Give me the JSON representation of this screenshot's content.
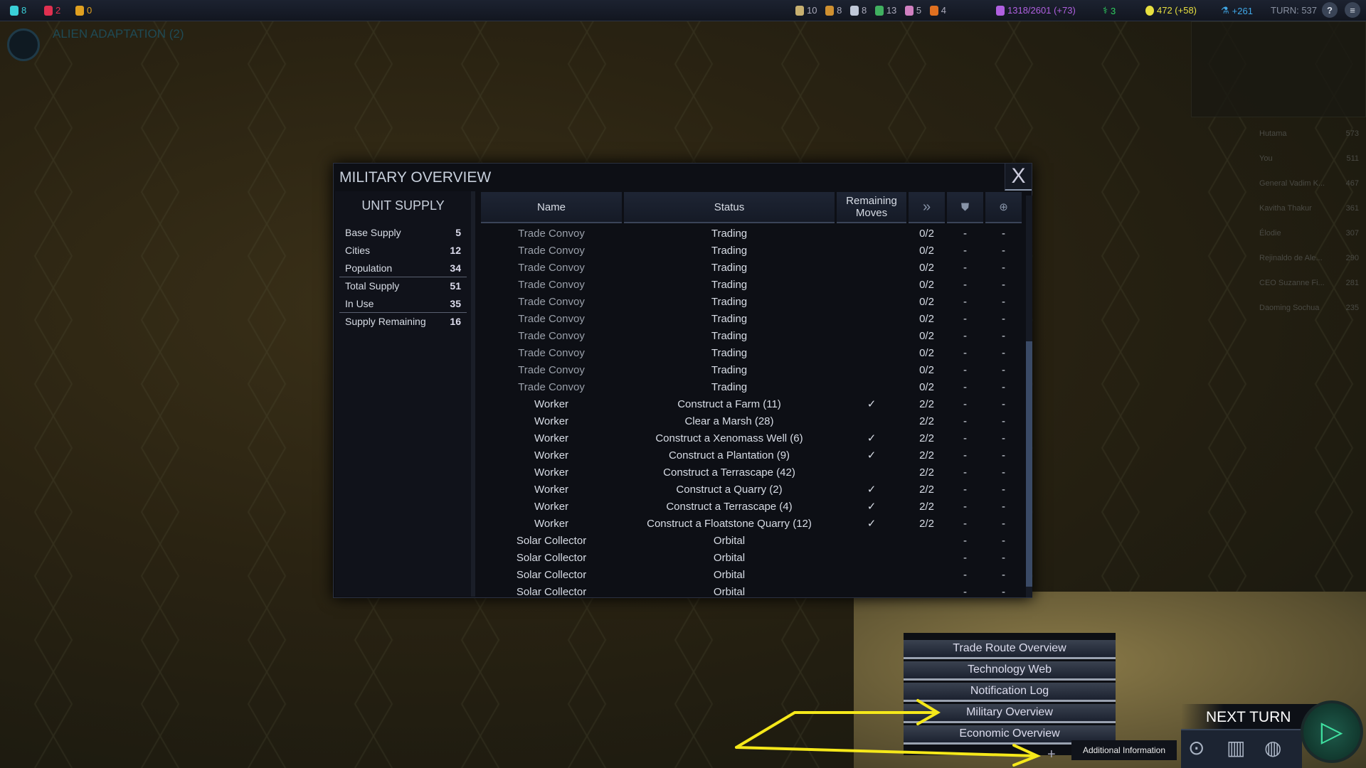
{
  "topbar": {
    "left": [
      {
        "icon": "affinity-harmony-icon",
        "value": "8",
        "color": "#3ad0d8"
      },
      {
        "icon": "affinity-purity-icon",
        "value": "2",
        "color": "#e03050"
      },
      {
        "icon": "affinity-supremacy-icon",
        "value": "0",
        "color": "#e0a020"
      }
    ],
    "resources": [
      {
        "icon": "firaxite-icon",
        "value": "10"
      },
      {
        "icon": "floatstone-icon",
        "value": "8"
      },
      {
        "icon": "titanium-icon",
        "value": "8"
      },
      {
        "icon": "geothermal-icon",
        "value": "13"
      },
      {
        "icon": "xenomass-icon",
        "value": "5"
      },
      {
        "icon": "petroleum-icon",
        "value": "4"
      }
    ],
    "culture": "1318/2601 (+73)",
    "health": "3",
    "energy": "472 (+58)",
    "science": "+261",
    "turn": "TURN: 537"
  },
  "quest": {
    "title": "ALIEN ADAPTATION (2)"
  },
  "scoreboard": [
    {
      "name": "Hutama",
      "score": "573"
    },
    {
      "name": "You",
      "score": "511"
    },
    {
      "name": "General Vadim K...",
      "score": "467"
    },
    {
      "name": "Kavitha Thakur",
      "score": "361"
    },
    {
      "name": "Élodie",
      "score": "307"
    },
    {
      "name": "Rejinaldo de Ale...",
      "score": "290"
    },
    {
      "name": "CEO Suzanne Fi...",
      "score": "281"
    },
    {
      "name": "Daoming Sochua",
      "score": "235"
    }
  ],
  "panel": {
    "title": "MILITARY OVERVIEW",
    "close": "X",
    "supply": {
      "title": "UNIT SUPPLY",
      "rows": [
        {
          "label": "Base Supply",
          "value": "5"
        },
        {
          "label": "Cities",
          "value": "12"
        },
        {
          "label": "Population",
          "value": "34"
        },
        {
          "label": "Total Supply",
          "value": "51"
        },
        {
          "label": "In Use",
          "value": "35"
        },
        {
          "label": "Supply Remaining",
          "value": "16"
        }
      ]
    },
    "columns": {
      "name": "Name",
      "status": "Status",
      "remaining": "Remaining Moves",
      "moves_icon": "moves-icon",
      "defense_icon": "shield-icon",
      "ranged_icon": "target-icon"
    },
    "units": [
      {
        "name": "Trade Convoy",
        "status": "Trading",
        "check": "",
        "moves": "0/2",
        "def": "-",
        "rng": "-"
      },
      {
        "name": "Trade Convoy",
        "status": "Trading",
        "check": "",
        "moves": "0/2",
        "def": "-",
        "rng": "-"
      },
      {
        "name": "Trade Convoy",
        "status": "Trading",
        "check": "",
        "moves": "0/2",
        "def": "-",
        "rng": "-"
      },
      {
        "name": "Trade Convoy",
        "status": "Trading",
        "check": "",
        "moves": "0/2",
        "def": "-",
        "rng": "-"
      },
      {
        "name": "Trade Convoy",
        "status": "Trading",
        "check": "",
        "moves": "0/2",
        "def": "-",
        "rng": "-"
      },
      {
        "name": "Trade Convoy",
        "status": "Trading",
        "check": "",
        "moves": "0/2",
        "def": "-",
        "rng": "-"
      },
      {
        "name": "Trade Convoy",
        "status": "Trading",
        "check": "",
        "moves": "0/2",
        "def": "-",
        "rng": "-"
      },
      {
        "name": "Trade Convoy",
        "status": "Trading",
        "check": "",
        "moves": "0/2",
        "def": "-",
        "rng": "-"
      },
      {
        "name": "Trade Convoy",
        "status": "Trading",
        "check": "",
        "moves": "0/2",
        "def": "-",
        "rng": "-"
      },
      {
        "name": "Trade Convoy",
        "status": "Trading",
        "check": "",
        "moves": "0/2",
        "def": "-",
        "rng": "-"
      },
      {
        "name": "Worker",
        "status": "Construct a Farm (11)",
        "check": "✓",
        "moves": "2/2",
        "def": "-",
        "rng": "-"
      },
      {
        "name": "Worker",
        "status": "Clear a Marsh (28)",
        "check": "",
        "moves": "2/2",
        "def": "-",
        "rng": "-"
      },
      {
        "name": "Worker",
        "status": "Construct a Xenomass Well (6)",
        "check": "✓",
        "moves": "2/2",
        "def": "-",
        "rng": "-"
      },
      {
        "name": "Worker",
        "status": "Construct a Plantation (9)",
        "check": "✓",
        "moves": "2/2",
        "def": "-",
        "rng": "-"
      },
      {
        "name": "Worker",
        "status": "Construct a Terrascape (42)",
        "check": "",
        "moves": "2/2",
        "def": "-",
        "rng": "-"
      },
      {
        "name": "Worker",
        "status": "Construct a Quarry (2)",
        "check": "✓",
        "moves": "2/2",
        "def": "-",
        "rng": "-"
      },
      {
        "name": "Worker",
        "status": "Construct a Terrascape (4)",
        "check": "✓",
        "moves": "2/2",
        "def": "-",
        "rng": "-"
      },
      {
        "name": "Worker",
        "status": "Construct a Floatstone Quarry (12)",
        "check": "✓",
        "moves": "2/2",
        "def": "-",
        "rng": "-"
      },
      {
        "name": "Solar Collector",
        "status": "Orbital",
        "check": "",
        "moves": "",
        "def": "-",
        "rng": "-"
      },
      {
        "name": "Solar Collector",
        "status": "Orbital",
        "check": "",
        "moves": "",
        "def": "-",
        "rng": "-"
      },
      {
        "name": "Solar Collector",
        "status": "Orbital",
        "check": "",
        "moves": "",
        "def": "-",
        "rng": "-"
      },
      {
        "name": "Solar Collector",
        "status": "Orbital",
        "check": "",
        "moves": "",
        "def": "-",
        "rng": "-"
      }
    ]
  },
  "menu": {
    "items": [
      "Trade Route Overview",
      "Technology Web",
      "Notification Log",
      "Military Overview",
      "Economic Overview"
    ],
    "tooltip": "Additional Information",
    "plus": "+"
  },
  "next_turn": {
    "label": "NEXT TURN"
  },
  "annotation_color": "#f5e81a"
}
